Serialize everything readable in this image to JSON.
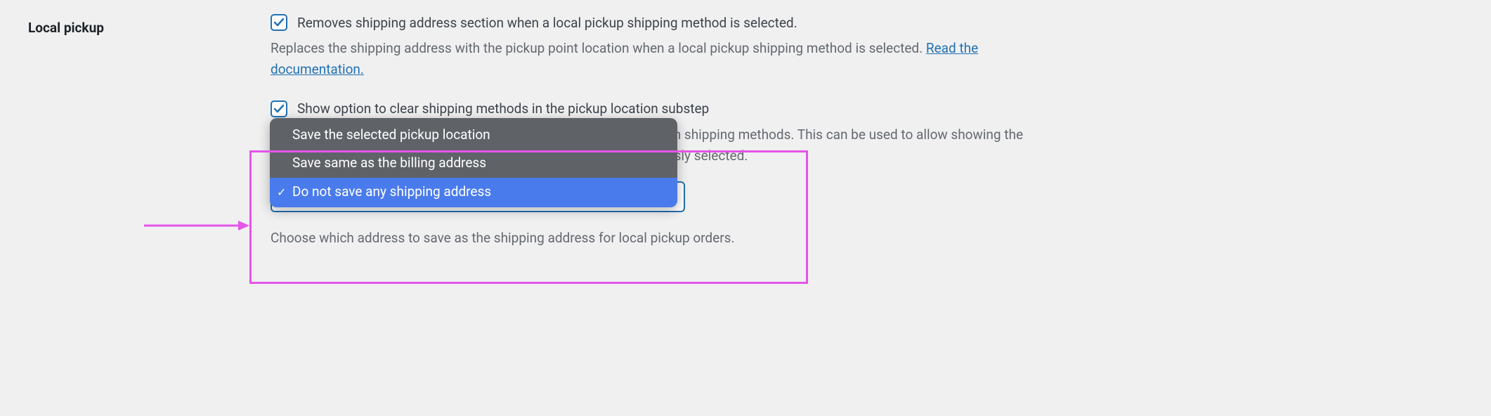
{
  "section": {
    "title": "Local pickup"
  },
  "option1": {
    "label": "Removes shipping address section when a local pickup shipping method is selected.",
    "description_prefix": "Replaces the shipping address with the pickup point location when a local pickup shipping method is selected. ",
    "link_text": "Read the documentation."
  },
  "option2": {
    "label": "Show option to clear shipping methods in the pickup location substep",
    "description": "Show a link button on the pickup location substep to clear the chosen shipping methods. This can be used to allow showing the shipping address section again if a local pickup method was previously selected."
  },
  "dropdown": {
    "options": {
      "0": "Save the selected pickup location",
      "1": "Save same as the billing address",
      "2": "Do not save any shipping address"
    },
    "description": "Choose which address to save as the shipping address for local pickup orders."
  }
}
